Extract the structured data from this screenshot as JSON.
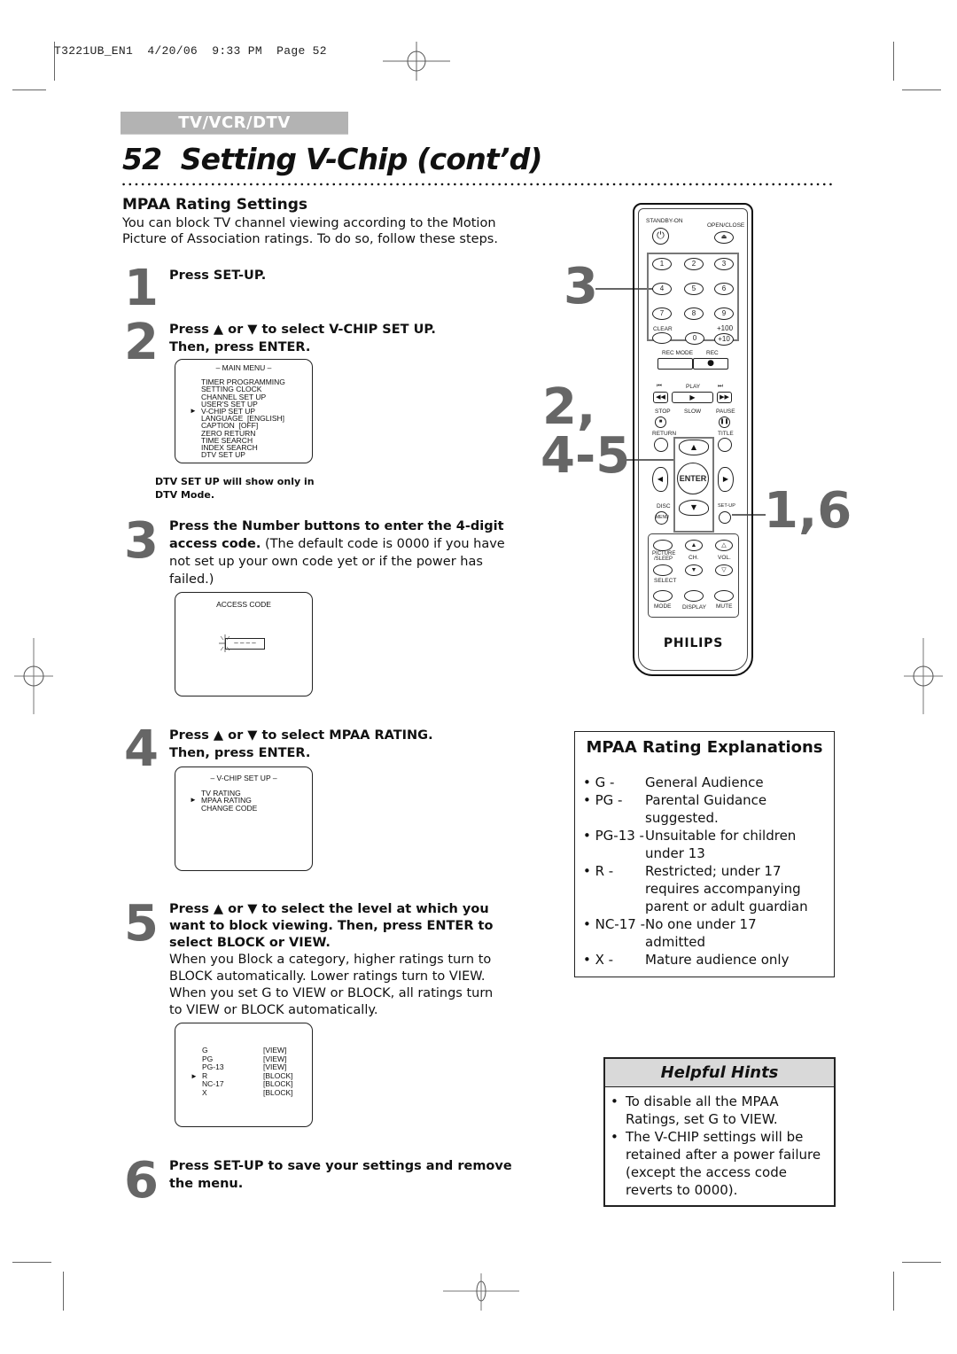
{
  "print_header": "T3221UB_EN1  4/20/06  9:33 PM  Page 52",
  "section_tab": "TV/VCR/DTV",
  "page_title": "52  Setting V-Chip (cont’d)",
  "intro": {
    "heading": "MPAA Rating Settings",
    "text_line1": "You can block TV channel viewing according to the Motion",
    "text_line2": "Picture of Association ratings. To do so, follow these steps."
  },
  "steps": [
    {
      "num": "1",
      "bold": "Press SET-UP."
    },
    {
      "num": "2",
      "line1": "Press ▲ or ▼ to select V-CHIP SET UP.",
      "line2": "Then, press ENTER."
    },
    {
      "num": "3",
      "bold_line1": "Press the Number buttons to enter the 4-digit",
      "bold_line2": "access code.",
      "rest_line2": " (The default code is 0000 if you have",
      "line3": "not set up your own code yet or if the power has",
      "line4": "failed.)"
    },
    {
      "num": "4",
      "line1": "Press ▲ or ▼ to select MPAA RATING.",
      "line2": "Then, press ENTER."
    },
    {
      "num": "5",
      "bold_line1": "Press ▲ or ▼ to select the level at which you",
      "bold_line2": "want to block viewing. Then, press ENTER to",
      "bold_line3": "select BLOCK or VIEW.",
      "line4": "When you Block a category, higher ratings turn to",
      "line5": "BLOCK automatically. Lower ratings turn to VIEW.",
      "line6": "When you set G to VIEW or BLOCK, all ratings turn",
      "line7": "to VIEW or BLOCK automatically."
    },
    {
      "num": "6",
      "line1": "Press SET-UP to save your settings and remove",
      "line2": "the menu."
    }
  ],
  "main_menu_screen": {
    "title": "– MAIN MENU –",
    "items": [
      "TIMER PROGRAMMING",
      "SETTING CLOCK",
      "CHANNEL SET UP",
      "USER'S SET UP",
      "V-CHIP SET UP",
      "LANGUAGE  [ENGLISH]",
      "CAPTION  [OFF]",
      "ZERO RETURN",
      "TIME SEARCH",
      "INDEX SEARCH",
      "DTV SET UP"
    ],
    "selected_index": 4
  },
  "dtv_note": {
    "line1": "DTV SET UP will show only in",
    "line2": "DTV Mode."
  },
  "access_code_screen": {
    "title": "ACCESS CODE",
    "code_placeholder": "– – – –"
  },
  "vchip_screen": {
    "title": "– V-CHIP SET UP –",
    "items": [
      "TV RATING",
      "MPAA RATING",
      "CHANGE CODE"
    ],
    "selected_index": 1
  },
  "rating_screen": {
    "rows": [
      {
        "rating": "G",
        "status": "[VIEW]"
      },
      {
        "rating": "PG",
        "status": "[VIEW]"
      },
      {
        "rating": "PG-13",
        "status": "[VIEW]"
      },
      {
        "rating": "R",
        "status": "[BLOCK]"
      },
      {
        "rating": "NC-17",
        "status": "[BLOCK]"
      },
      {
        "rating": "X",
        "status": "[BLOCK]"
      }
    ],
    "selected_index": 3
  },
  "remote": {
    "standby": "STANDBY-ON",
    "open_close": "OPEN/CLOSE",
    "digits": [
      "1",
      "2",
      "3",
      "4",
      "5",
      "6",
      "7",
      "8",
      "9"
    ],
    "clear": "CLEAR",
    "zero": "0",
    "plus100": "+100",
    "plus10": "+10",
    "rec_mode": "REC MODE",
    "rec": "REC",
    "play": "PLAY",
    "stop": "STOP",
    "slow": "SLOW",
    "pause": "PAUSE",
    "return": "RETURN",
    "title": "TITLE",
    "enter": "ENTER",
    "disc": "DISC",
    "menu": "MENU",
    "setup": "SET-UP",
    "picture_sleep_1": "PICTURE",
    "picture_sleep_2": "/SLEEP",
    "ch": "CH.",
    "vol": "VOL.",
    "select": "SELECT",
    "mode": "MODE",
    "display": "DISPLAY",
    "mute": "MUTE",
    "brand": "PHILIPS"
  },
  "callouts": {
    "c3": "3",
    "c2": "2,",
    "c45": "4-5",
    "c16": "1,6"
  },
  "explanations": {
    "heading": "MPAA Rating Explanations",
    "items": [
      {
        "key": "• G -",
        "lines": [
          "General Audience"
        ]
      },
      {
        "key": "• PG -",
        "lines": [
          "Parental Guidance",
          "suggested."
        ]
      },
      {
        "key": "• PG-13 -",
        "lines": [
          "Unsuitable for children",
          "under 13"
        ]
      },
      {
        "key": "• R -",
        "lines": [
          "Restricted; under 17",
          "requires accompanying",
          "parent or adult guardian"
        ]
      },
      {
        "key": "• NC-17 -",
        "lines": [
          "No one under 17",
          "admitted"
        ]
      },
      {
        "key": "• X -",
        "lines": [
          "Mature audience only"
        ]
      }
    ]
  },
  "hints": {
    "heading": "Helpful Hints",
    "items": [
      {
        "line1": "To disable all the MPAA",
        "line2": "Ratings, set G to VIEW."
      },
      {
        "line1": "The V-CHIP settings will be",
        "line2": "retained after a power failure",
        "line3": "(except the access code",
        "line4": "reverts to 0000)."
      }
    ]
  },
  "colors": {
    "step_number": "#666666",
    "section_tab_bg": "#b3b3b3",
    "hints_header_bg": "#d9d9d9"
  }
}
